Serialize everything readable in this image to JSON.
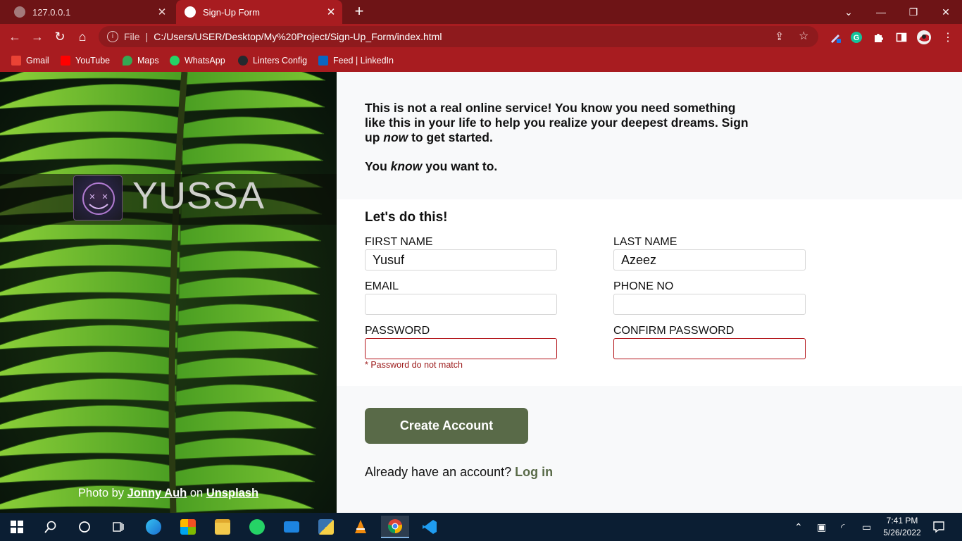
{
  "browser": {
    "tabs": [
      {
        "title": "127.0.0.1",
        "close": "✕",
        "active": false
      },
      {
        "title": "Sign-Up Form",
        "close": "✕",
        "active": true
      }
    ],
    "new_tab": "+",
    "window_controls": {
      "minimize": "—",
      "restore": "❐",
      "close": "✕",
      "tab_search": "⌄"
    },
    "address": {
      "scheme_label": "File",
      "url": "C:/Users/USER/Desktop/My%20Project/Sign-Up_Form/index.html"
    },
    "bookmarks": [
      {
        "label": "Gmail",
        "icon": "gmail-icon",
        "color": "#ea4335"
      },
      {
        "label": "YouTube",
        "icon": "youtube-icon",
        "color": "#ff0000"
      },
      {
        "label": "Maps",
        "icon": "maps-icon",
        "color": "#34a853"
      },
      {
        "label": "WhatsApp",
        "icon": "whatsapp-icon",
        "color": "#25d366"
      },
      {
        "label": "Linters Config",
        "icon": "github-icon",
        "color": "#24292e"
      },
      {
        "label": "Feed | LinkedIn",
        "icon": "linkedin-icon",
        "color": "#0a66c2"
      }
    ],
    "accent_color": "#a81c20",
    "tabstrip_color": "#6e1416"
  },
  "page": {
    "brand": {
      "name": "YUSSA",
      "logo": "purple-smiley-logo"
    },
    "photo_credit": {
      "prefix": "Photo by",
      "author": "Jonny Auh",
      "on": "on",
      "site": "Unsplash"
    },
    "intro": {
      "line1": "This is not a real online service! You know you need something like this in your life to help you realize your deepest dreams. Sign up ",
      "line1_em": "now",
      "line1_end": " to get started.",
      "line2_start": "You ",
      "line2_em": "know",
      "line2_end": " you want to."
    },
    "form": {
      "title": "Let's do this!",
      "first_name": {
        "label": "FIRST NAME",
        "value": "Yusuf"
      },
      "last_name": {
        "label": "LAST NAME",
        "value": "Azeez"
      },
      "email": {
        "label": "EMAIL",
        "value": ""
      },
      "phone": {
        "label": "PHONE NO",
        "value": ""
      },
      "password": {
        "label": "PASSWORD",
        "value": "",
        "error": "* Password do not match"
      },
      "confirm_password": {
        "label": "CONFIRM PASSWORD",
        "value": ""
      }
    },
    "submit_label": "Create Account",
    "login_prompt": "Already have an account?",
    "login_link": "Log in",
    "button_color": "#596a48",
    "error_color": "#b3141a"
  },
  "taskbar": {
    "apps": [
      "start-icon",
      "search-icon",
      "cortana-icon",
      "task-view-icon",
      "edge-icon",
      "store-icon",
      "file-explorer-icon",
      "whatsapp-icon",
      "mail-icon",
      "python-icon",
      "vlc-icon",
      "chrome-icon",
      "vscode-icon"
    ],
    "active_app": "chrome-icon",
    "clock": {
      "time": "7:41 PM",
      "date": "5/26/2022"
    }
  }
}
